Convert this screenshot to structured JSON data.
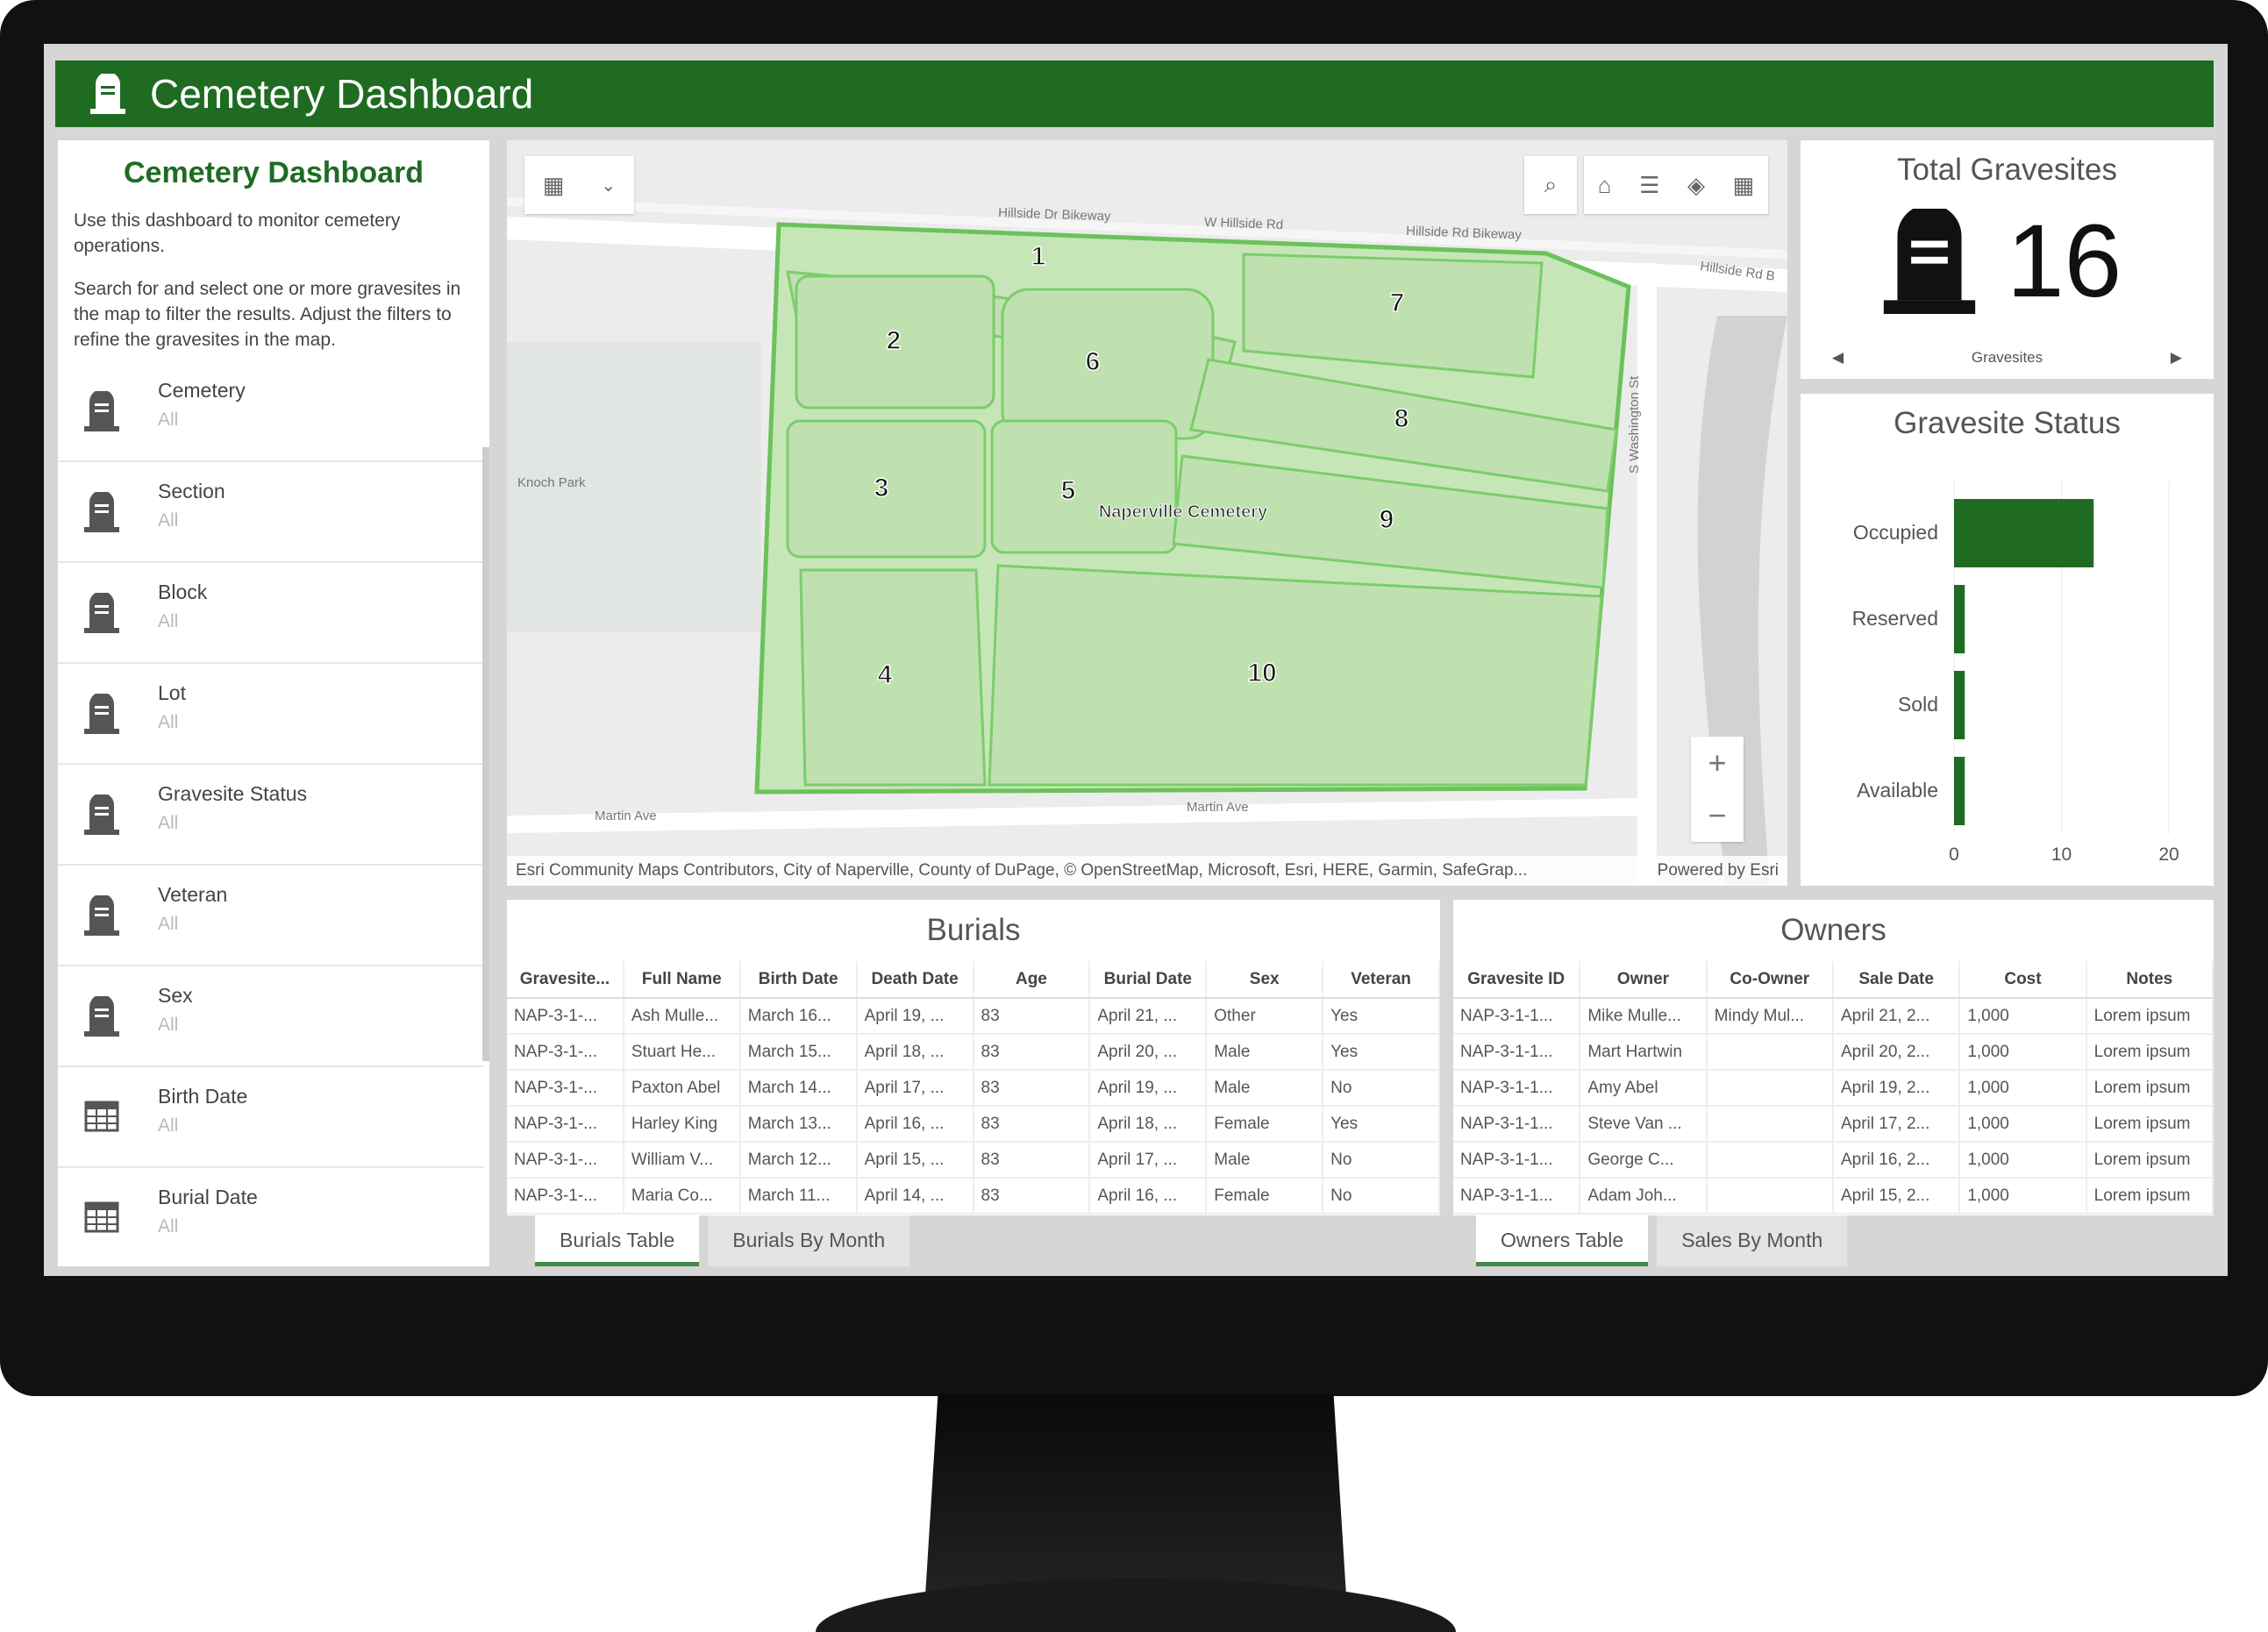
{
  "header": {
    "title": "Cemetery Dashboard",
    "icon": "headstone-icon"
  },
  "sidebar": {
    "title": "Cemetery Dashboard",
    "intro": "Use this dashboard to monitor cemetery operations.",
    "instructions": "Search for and select one or more gravesites in the map to filter the results. Adjust the filters to refine the gravesites in the map.",
    "filters": [
      {
        "label": "Cemetery",
        "value": "All",
        "icon": "headstone-icon"
      },
      {
        "label": "Section",
        "value": "All",
        "icon": "headstone-icon"
      },
      {
        "label": "Block",
        "value": "All",
        "icon": "headstone-icon"
      },
      {
        "label": "Lot",
        "value": "All",
        "icon": "headstone-icon"
      },
      {
        "label": "Gravesite Status",
        "value": "All",
        "icon": "headstone-icon"
      },
      {
        "label": "Veteran",
        "value": "All",
        "icon": "headstone-icon"
      },
      {
        "label": "Sex",
        "value": "All",
        "icon": "headstone-icon"
      },
      {
        "label": "Birth Date",
        "value": "All",
        "icon": "calendar-icon"
      },
      {
        "label": "Burial Date",
        "value": "All",
        "icon": "calendar-icon"
      }
    ]
  },
  "map": {
    "roads": [
      "Hillside Dr Bikeway",
      "W Hillside Rd",
      "Hillside Rd Bikeway",
      "Hillside Rd B",
      "S Washington St",
      "Knoch Park",
      "Martin Ave",
      "Martin Ave"
    ],
    "cemetery_label": "Naperville Cemetery",
    "sections": [
      "1",
      "2",
      "3",
      "4",
      "5",
      "6",
      "7",
      "8",
      "9",
      "10"
    ],
    "attribution": "Esri Community Maps Contributors, City of Naperville, County of DuPage, © OpenStreetMap, Microsoft, Esri, HERE, Garmin, SafeGrap...",
    "powered": "Powered by Esri",
    "zoom_in": "+",
    "zoom_out": "−"
  },
  "total": {
    "title": "Total Gravesites",
    "value": "16",
    "label": "Gravesites"
  },
  "chart_data": {
    "type": "bar",
    "orientation": "horizontal",
    "title": "Gravesite Status",
    "categories": [
      "Occupied",
      "Reserved",
      "Sold",
      "Available"
    ],
    "values": [
      13,
      1,
      1,
      1
    ],
    "xlim": [
      0,
      20
    ],
    "xticks": [
      "0",
      "10",
      "20"
    ],
    "color": "#1f6b22"
  },
  "burials": {
    "title": "Burials",
    "columns": [
      "Gravesite...",
      "Full Name",
      "Birth Date",
      "Death Date",
      "Age",
      "Burial Date",
      "Sex",
      "Veteran"
    ],
    "rows": [
      [
        "NAP-3-1-...",
        "Ash Mulle...",
        "March 16...",
        "April 19, ...",
        "83",
        "April 21, ...",
        "Other",
        "Yes"
      ],
      [
        "NAP-3-1-...",
        "Stuart He...",
        "March 15...",
        "April 18, ...",
        "83",
        "April 20, ...",
        "Male",
        "Yes"
      ],
      [
        "NAP-3-1-...",
        "Paxton Abel",
        "March 14...",
        "April 17, ...",
        "83",
        "April 19, ...",
        "Male",
        "No"
      ],
      [
        "NAP-3-1-...",
        "Harley King",
        "March 13...",
        "April 16, ...",
        "83",
        "April 18, ...",
        "Female",
        "Yes"
      ],
      [
        "NAP-3-1-...",
        "William V...",
        "March 12...",
        "April 15, ...",
        "83",
        "April 17, ...",
        "Male",
        "No"
      ],
      [
        "NAP-3-1-...",
        "Maria Co...",
        "March 11...",
        "April 14, ...",
        "83",
        "April 16, ...",
        "Female",
        "No"
      ]
    ],
    "tabs": [
      "Burials Table",
      "Burials By Month"
    ]
  },
  "owners": {
    "title": "Owners",
    "columns": [
      "Gravesite ID",
      "Owner",
      "Co-Owner",
      "Sale Date",
      "Cost",
      "Notes"
    ],
    "rows": [
      [
        "NAP-3-1-1...",
        "Mike Mulle...",
        "Mindy Mul...",
        "April 21, 2...",
        "1,000",
        "Lorem ipsum"
      ],
      [
        "NAP-3-1-1...",
        "Mart Hartwin",
        "",
        "April 20, 2...",
        "1,000",
        "Lorem ipsum"
      ],
      [
        "NAP-3-1-1...",
        "Amy Abel",
        "",
        "April 19, 2...",
        "1,000",
        "Lorem ipsum"
      ],
      [
        "NAP-3-1-1...",
        "Steve Van ...",
        "",
        "April 17, 2...",
        "1,000",
        "Lorem ipsum"
      ],
      [
        "NAP-3-1-1...",
        "George C...",
        "",
        "April 16, 2...",
        "1,000",
        "Lorem ipsum"
      ],
      [
        "NAP-3-1-1...",
        "Adam Joh...",
        "",
        "April 15, 2...",
        "1,000",
        "Lorem ipsum"
      ]
    ],
    "tabs": [
      "Owners Table",
      "Sales By Month"
    ]
  }
}
